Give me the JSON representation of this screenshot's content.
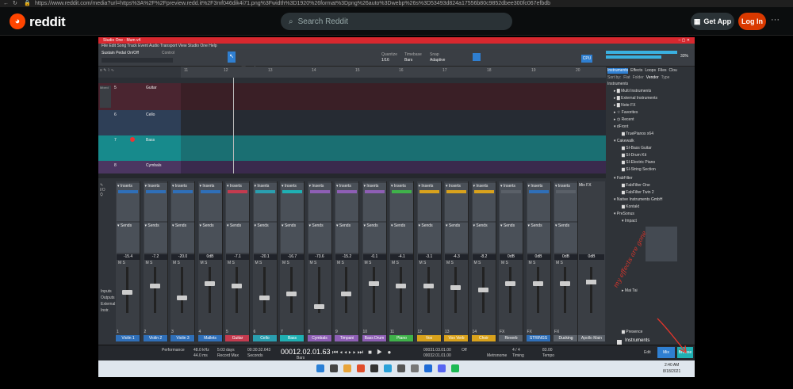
{
  "browser": {
    "url": "https://www.reddit.com/media?url=https%3A%2F%2Fpreview.redd.it%2F3mf046dik4i71.png%3Fwidth%3D1920%26format%3Dpng%26auto%3Dwebp%26s%3D53493d824a17556b80c9852dbee300fc067efbdb"
  },
  "reddit": {
    "brand": "reddit",
    "search_placeholder": "Search Reddit",
    "get_app": "Get App",
    "login": "Log In",
    "more": "···",
    "accent": "#ff4500"
  },
  "daw": {
    "title": "Studio One - Mum v4",
    "menu": "File  Edit  Song  Track  Event  Audio  Transport  View  Studio One  Help",
    "instrument": "Sustain Pedal On/Off",
    "control": "Control",
    "quantize_label": "Quantize",
    "quantize_value": "1/16",
    "timebase_label": "Timebase",
    "timebase_value": "Bars",
    "snap_label": "Snap",
    "snap_value": "Adaptive",
    "cpu": "33%",
    "browser_tabs": [
      "Instruments",
      "Effects",
      "Loops",
      "Files",
      "Clou"
    ],
    "sortby": "Sort by:",
    "sort_options": [
      "Flat",
      "Folder",
      "Vendor",
      "Type"
    ],
    "browser_items": [
      "Instruments",
      "Multi Instruments",
      "External Instruments",
      "Note FX",
      "Favorites",
      "Recent",
      "dFront",
      "TruePianos x64",
      "Cakewalk",
      "SI-Bass Guitar",
      "SI-Drum Kit",
      "SI-Electric Piano",
      "SI-String Section",
      "FabFilter",
      "FabFilter One",
      "FabFilter Twin 2",
      "Native Instruments GmbH",
      "Kontakt",
      "PreSonus",
      "Impact",
      "Mai Tai",
      "Presence"
    ],
    "preview_title": "Instruments",
    "preview_sub": "Instruments",
    "tracks": [
      {
        "n": "5",
        "name": "Guitar",
        "color": "#c43b4f"
      },
      {
        "n": "6",
        "name": "Cello",
        "color": "#3a7bc0"
      },
      {
        "n": "7",
        "name": "Bass",
        "color": "#1fb0b3"
      },
      {
        "n": "8",
        "name": "Cymbals",
        "color": "#8e5fb5"
      }
    ],
    "inputs_label": "Inputs",
    "outputs_label": "Outputs",
    "external_label": "External",
    "instr_label": "Instr.",
    "channels": [
      {
        "name": "Violin 1",
        "vol": "-15.4",
        "color": "#2f6fb8",
        "num": "1"
      },
      {
        "name": "Violin 2",
        "vol": "-7.2",
        "color": "#2f6fb8",
        "num": "2"
      },
      {
        "name": "Violin 3",
        "vol": "-20.0",
        "color": "#2f6fb8",
        "num": "3"
      },
      {
        "name": "Mallets",
        "vol": "0dB",
        "color": "#2f6fb8",
        "num": "4"
      },
      {
        "name": "Guitar",
        "vol": "-7.1",
        "color": "#c43b4f",
        "num": "5"
      },
      {
        "name": "Cello",
        "vol": "-20.1",
        "color": "#2a9fb0",
        "num": "6"
      },
      {
        "name": "Bass",
        "vol": "-16.7",
        "color": "#1fb0b3",
        "num": "7"
      },
      {
        "name": "Cymbals",
        "vol": "-73.6",
        "color": "#8e5fb5",
        "num": "8"
      },
      {
        "name": "Timpani",
        "vol": "-15.2",
        "color": "#8e5fb5",
        "num": "9"
      },
      {
        "name": "Bass Drum",
        "vol": "-0.1",
        "color": "#8e5fb5",
        "num": "10"
      },
      {
        "name": "Piano",
        "vol": "-4.1",
        "color": "#3fb24a",
        "num": "11"
      },
      {
        "name": "Vox",
        "vol": "-3.1",
        "color": "#d9a21c",
        "num": "12"
      },
      {
        "name": "Vox Verb",
        "vol": "-4.3",
        "color": "#d9a21c",
        "num": "13"
      },
      {
        "name": "Choir",
        "vol": "-8.2",
        "color": "#d9a21c",
        "num": "14"
      },
      {
        "name": "Reverb",
        "vol": "0dB",
        "color": "#5a6068",
        "num": "FX"
      },
      {
        "name": "STRINGS",
        "vol": "0dB",
        "color": "#2f6fb8",
        "num": "FX"
      },
      {
        "name": "Ducking",
        "vol": "0dB",
        "color": "#5a6068",
        "num": "FX"
      }
    ],
    "main_channel": {
      "name": "Apollo Main",
      "vol": "0dB",
      "title": "Mix FX"
    },
    "transport": {
      "sample_rate": "48.0 kHz",
      "latency": "44.0 ms",
      "days": "5:03 days",
      "record_max": "Record Max",
      "time": "00:30:32.643",
      "seconds": "Seconds",
      "position": "00012.02.01.63",
      "bars": "Bars",
      "loop_start": "00031.03.01.00",
      "loop_end": "00032.01.01.00",
      "sync": "Off",
      "metronome": "Metronome",
      "signature": "4 / 4",
      "timing": "Timing",
      "tempo": "83.00",
      "tempo_label": "Tempo",
      "perf": "Performance",
      "edit": "Edit",
      "mix": "Mix",
      "browse": "Browse"
    },
    "taskbar": {
      "time": "2:40 AM",
      "date": "8/18/2021"
    }
  },
  "annotation": {
    "text": "my effects are gone"
  }
}
